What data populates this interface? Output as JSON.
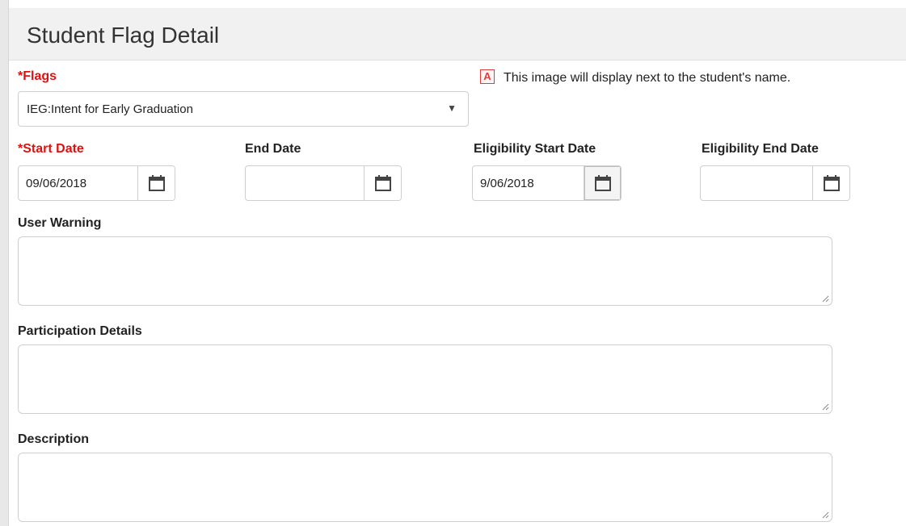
{
  "page": {
    "title": "Student Flag Detail"
  },
  "flags": {
    "required_marker": "*",
    "label": "Flags",
    "selected_value": "IEG:Intent for Early Graduation",
    "caret": "▼"
  },
  "image_info": {
    "icon_glyph": "A",
    "text": "This image will display next to the student's name."
  },
  "dates": {
    "start": {
      "required_marker": "*",
      "label": "Start Date",
      "value": "09/06/2018"
    },
    "end": {
      "label": "End Date",
      "value": ""
    },
    "eligibility_start": {
      "label": "Eligibility Start Date",
      "value": "9/06/2018"
    },
    "eligibility_end": {
      "label": "Eligibility End Date",
      "value": ""
    }
  },
  "user_warning": {
    "label": "User Warning",
    "value": ""
  },
  "participation_details": {
    "label": "Participation Details",
    "value": ""
  },
  "description": {
    "label": "Description",
    "value": ""
  },
  "colors": {
    "required": "#e01010",
    "header_bg": "#f1f1f1",
    "border": "#cfcfcf"
  },
  "icons": {
    "calendar": "calendar-icon",
    "dropdown": "chevron-down-icon",
    "image_marker": "image-marker-icon",
    "resize": "resize-grip-icon"
  }
}
